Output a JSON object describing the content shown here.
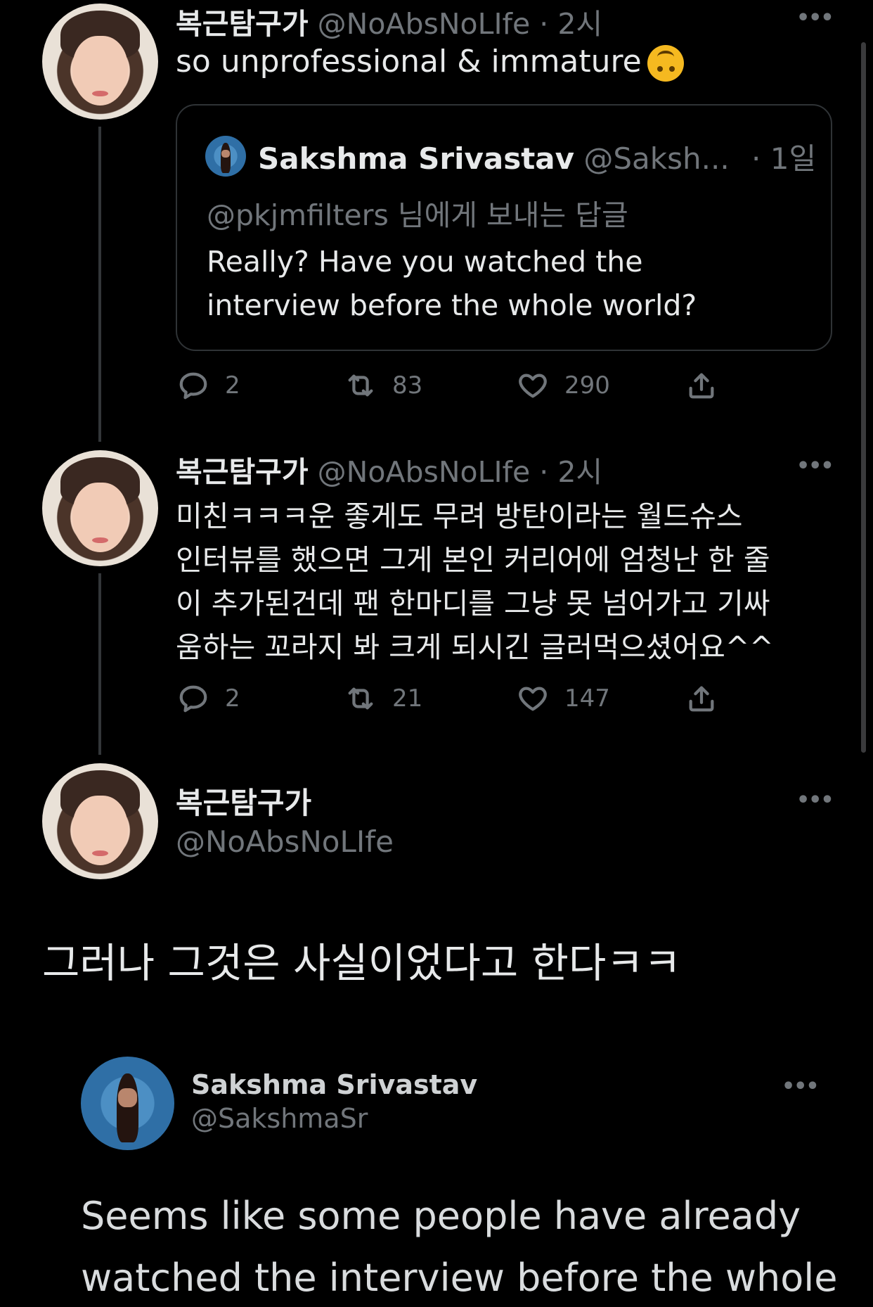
{
  "tweet1": {
    "name": "복근탐구가",
    "handle": "@NoAbsNoLIfe",
    "time": "· 2시",
    "text": "so unprofessional & immature",
    "emoji": "upside-down-face-icon",
    "quote": {
      "name": "Sakshma Srivastav",
      "handle": "@Saksh...",
      "time": "· 1일",
      "reply_to": "@pkjmfilters 님에게 보내는 답글",
      "line1": "Really? Have you watched the",
      "line2": "interview before the whole world?"
    },
    "replies": "2",
    "retweets": "83",
    "likes": "290"
  },
  "tweet2": {
    "name": "복근탐구가",
    "handle": "@NoAbsNoLIfe",
    "time": "· 2시",
    "line1": "미친ㅋㅋㅋ운 좋게도 무려 방탄이라는 월드슈스",
    "line2": "인터뷰를 했으면 그게 본인 커리어에 엄청난 한 줄",
    "line3": "이 추가된건데 팬 한마디를 그냥 못 넘어가고 기싸",
    "line4": "움하는 꼬라지 봐 크게 되시긴 글러먹으셨어요^^",
    "replies": "2",
    "retweets": "21",
    "likes": "147"
  },
  "tweet3": {
    "name": "복근탐구가",
    "handle": "@NoAbsNoLIfe",
    "text": "그러나 그것은 사실이었다고 한다ㅋㅋ"
  },
  "embedded": {
    "name": "Sakshma Srivastav",
    "handle": "@SakshmaSr",
    "line1": "Seems like some people have already",
    "line2": "watched the interview before the whole"
  },
  "colors": {
    "background": "#000000",
    "text": "#e7e9ea",
    "muted": "#71767b",
    "border": "#2f3336"
  }
}
